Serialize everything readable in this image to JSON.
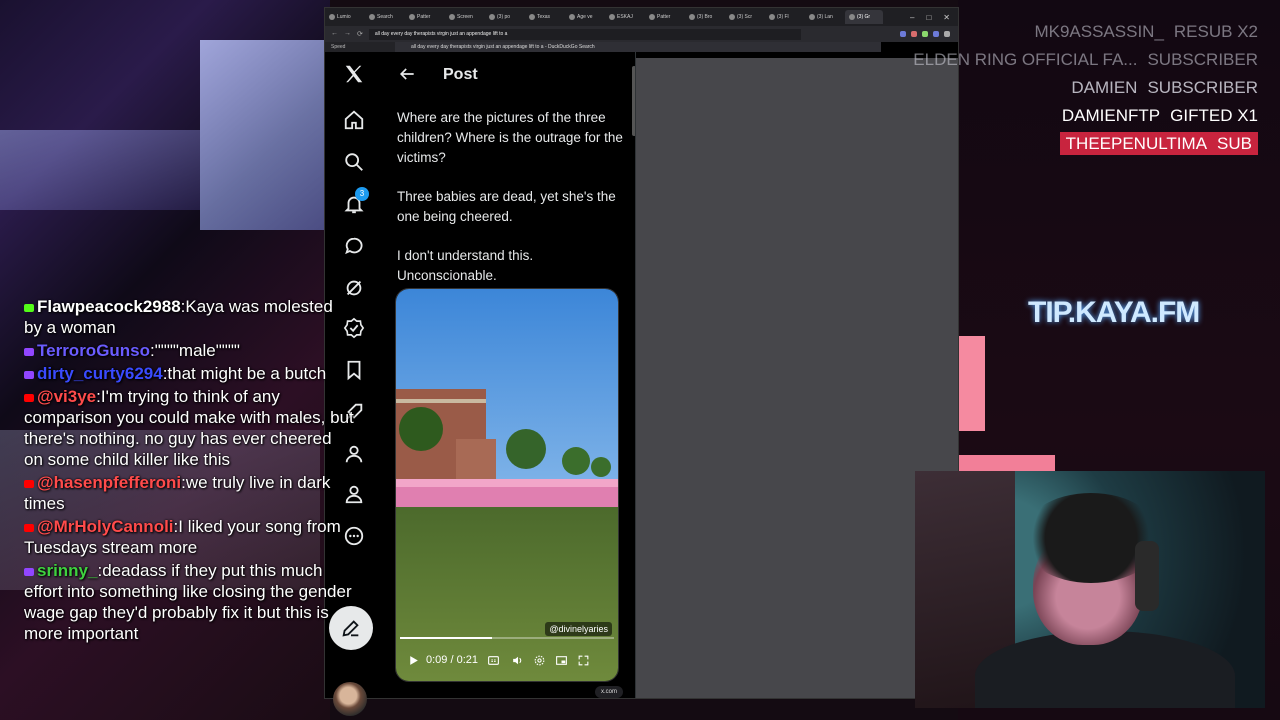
{
  "browser": {
    "tabs": [
      {
        "label": "Lumio",
        "active": false
      },
      {
        "label": "Search",
        "active": false
      },
      {
        "label": "Patter",
        "active": false
      },
      {
        "label": "Screen",
        "active": false
      },
      {
        "label": "(3) po",
        "active": false
      },
      {
        "label": "Texas",
        "active": false
      },
      {
        "label": "Age ve",
        "active": false
      },
      {
        "label": "ESKAJ",
        "active": false
      },
      {
        "label": "Patter",
        "active": false
      },
      {
        "label": "(3) Bro",
        "active": false
      },
      {
        "label": "(3) Scr",
        "active": false
      },
      {
        "label": "(3) Fl",
        "active": false
      },
      {
        "label": "(3) Lan",
        "active": false
      },
      {
        "label": "(3) Gr",
        "active": true
      }
    ],
    "address_value": "all day every day therapists virgin just an appendage lift to a",
    "suggestion": "all day every day therapists virgin just an appendage lift to a - DuckDuckGo Search",
    "bookmark": "Speed",
    "status_pill": "x.com"
  },
  "x": {
    "nav": {
      "notification_count": "3"
    },
    "post": {
      "header_title": "Post",
      "paragraphs": [
        "Where are the pictures of the three children? Where is the outrage for the victims?",
        "Three babies are dead, yet she's the one being cheered.",
        "I don't understand this. Unconscionable."
      ],
      "video": {
        "watermark": "@divinelyaries",
        "time": "0:09 / 0:21",
        "progress": 0.43
      }
    }
  },
  "overlays": {
    "alerts": [
      {
        "who": "MK9ASSASSIN_",
        "what": "RESUB X2",
        "style": "dim"
      },
      {
        "who": "ELDEN RING OFFICIAL FA...",
        "what": "SUBSCRIBER",
        "style": "dim"
      },
      {
        "who": "DAMIEN",
        "what": "SUBSCRIBER",
        "style": "mid"
      },
      {
        "who": "DAMIENFTP",
        "what": "GIFTED X1",
        "style": "bright"
      },
      {
        "who": "THEEPENULTIMA",
        "what": "SUB",
        "style": "hl"
      }
    ],
    "tip": "TIP.KAYA.FM"
  },
  "chat": [
    {
      "platform": "kick",
      "user": "Flawpeacock2988",
      "user_color": "#ffffff",
      "text": "Kaya was molested by a woman"
    },
    {
      "platform": "twitch",
      "user": "TerroroGunso",
      "user_color": "#6b5cff",
      "text": "\"\"\"\"male\"\"\"\""
    },
    {
      "platform": "twitch",
      "user": "dirty_curty6294",
      "user_color": "#3a4bff",
      "text": "that might be a butch"
    },
    {
      "platform": "youtube",
      "user": "@vi3ye",
      "user_color": "#ff4b4b",
      "text": "I'm trying to think of any comparison you could make with males, but there's nothing. no guy has ever cheered on some child killer like this"
    },
    {
      "platform": "youtube",
      "user": "@hasenpfefferoni",
      "user_color": "#ff4b4b",
      "text": "we truly live in dark times"
    },
    {
      "platform": "youtube",
      "user": "@MrHolyCannoli",
      "user_color": "#ff4b4b",
      "text": "I liked your song from Tuesdays stream more"
    },
    {
      "platform": "twitch",
      "user": "srinny_",
      "user_color": "#3fd13f",
      "text": "deadass if they put this much effort into something like closing the gender wage gap they'd probably fix it but this is more important"
    }
  ],
  "colors": {
    "accent_blue": "#1d9bf0",
    "alert_highlight": "#c8243e",
    "tip_glow": "#5aa9ff"
  }
}
